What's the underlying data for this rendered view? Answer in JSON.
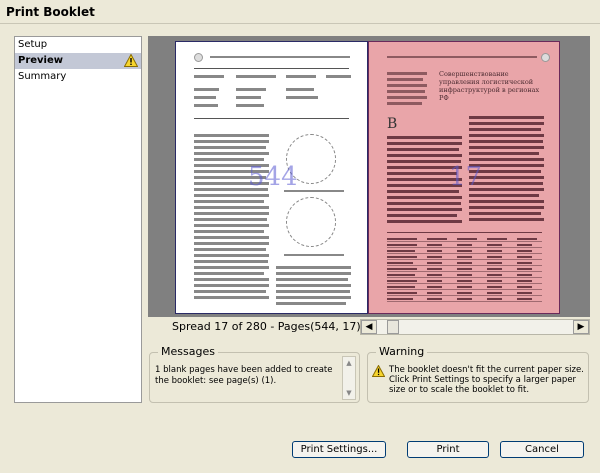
{
  "window": {
    "title": "Print Booklet"
  },
  "nav": {
    "items": [
      {
        "label": "Setup"
      },
      {
        "label": "Preview",
        "warning": true
      },
      {
        "label": "Summary"
      }
    ]
  },
  "preview": {
    "left_page_number": "544",
    "right_page_number": "17",
    "right_page_drop_cap": "B",
    "right_page_title": "Совершенствование управления логистической инфраструктурой в регионах РФ",
    "spread_info": "Spread 17 of 280 - Pages(544, 17)"
  },
  "messages": {
    "legend": "Messages",
    "text": "1 blank pages have been added to create the booklet: see page(s) (1)."
  },
  "warning": {
    "legend": "Warning",
    "text": "The booklet doesn't fit the current paper size. Click Print Settings to specify a larger paper size or to scale the booklet to fit."
  },
  "buttons": {
    "print_settings": "Print Settings...",
    "print": "Print",
    "cancel": "Cancel"
  },
  "colors": {
    "overflow_page": "#e9a5a9",
    "selected_nav": "#c3c8d6",
    "preview_bg": "#808080"
  }
}
